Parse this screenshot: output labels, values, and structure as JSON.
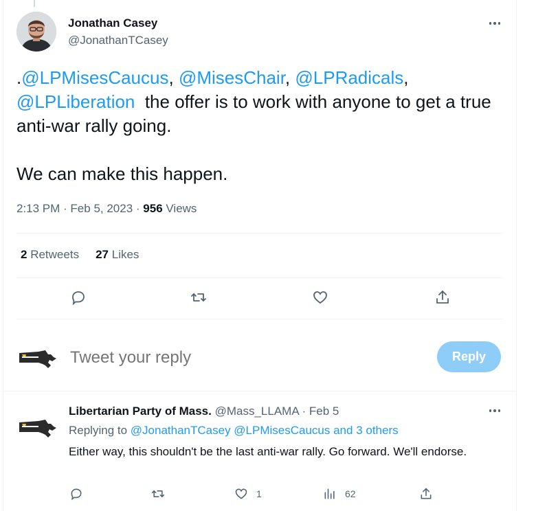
{
  "tweet": {
    "author_name": "Jonathan Casey",
    "author_handle": "@JonathanTCasey",
    "text_prefix": ".",
    "mentions": [
      "@LPMisesCaucus",
      "@MisesChair",
      "@LPRadicals",
      "@LPLiberation"
    ],
    "separator": ", ",
    "text_line1_end": ",",
    "text_body": "  the offer is to work with anyone to get a true anti-war rally going.",
    "text_second_paragraph": "We can make this happen.",
    "time": "2:13 PM",
    "date": "Feb 5, 2023",
    "meta_sep": " · ",
    "views_count": "956",
    "views_label": "Views",
    "retweets_count": "2",
    "retweets_label": "Retweets",
    "likes_count": "27",
    "likes_label": "Likes"
  },
  "compose": {
    "placeholder": "Tweet your reply",
    "reply_button": "Reply"
  },
  "reply": {
    "author_name": "Libertarian Party of Mass.",
    "author_handle": "@Mass_LLAMA",
    "date": "Feb 5",
    "dot": "·",
    "replying_label": "Replying to",
    "replying_to": "@JonathanTCasey @LPMisesCaucus and 3 others",
    "text": "Either way, this shouldn't be the last anti-war rally. Go forward. We'll endorse.",
    "likes": "1",
    "views": "62"
  },
  "icons": {
    "reply": "reply-bubble-icon",
    "retweet": "retweet-icon",
    "like": "heart-icon",
    "share": "share-upload-icon",
    "views": "views-bar-chart-icon",
    "more": "more-dots-icon"
  },
  "colors": {
    "link": "#1d9bf0",
    "secondary_text": "#536471",
    "reply_button_disabled": "#8ecdf8",
    "divider": "#eff3f4"
  }
}
